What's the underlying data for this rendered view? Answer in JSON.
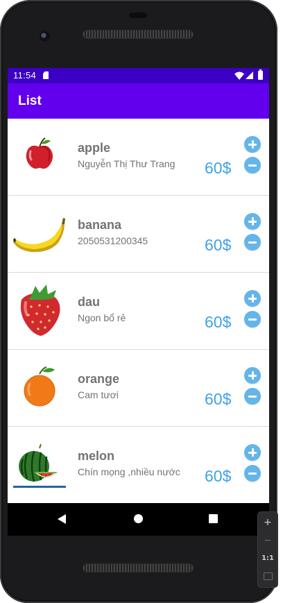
{
  "status_bar": {
    "time": "11:54",
    "icons": [
      "sd-card-icon",
      "wifi-icon",
      "signal-icon",
      "battery-icon"
    ]
  },
  "app_bar": {
    "title": "List",
    "color": "#6200ee",
    "status_color": "#3b00c4"
  },
  "items": [
    {
      "name": "apple",
      "description": "Nguyễn Thị Thư Trang",
      "price": "60$",
      "image": "apple-image"
    },
    {
      "name": "banana",
      "description": "2050531200345",
      "price": "60$",
      "image": "banana-image"
    },
    {
      "name": "dau",
      "description": "Ngon bổ rẻ",
      "price": "60$",
      "image": "strawberry-image"
    },
    {
      "name": "orange",
      "description": "Cam tươi",
      "price": "60$",
      "image": "orange-image"
    },
    {
      "name": "melon",
      "description": "Chín mọng ,nhiều nước",
      "price": "60$",
      "image": "watermelon-image"
    }
  ],
  "item_buttons": {
    "increase_icon": "plus-circle-icon",
    "decrease_icon": "minus-circle-icon",
    "color": "#64b5e9"
  },
  "price_color": "#3fa2e8",
  "nav_bar": {
    "icons": [
      "back-icon",
      "home-icon",
      "recents-icon"
    ]
  },
  "emulator_toolbar": {
    "zoom_in": "+",
    "zoom_out": "−",
    "actual_size": "1:1",
    "fit_icon": "fit-screen-icon"
  }
}
